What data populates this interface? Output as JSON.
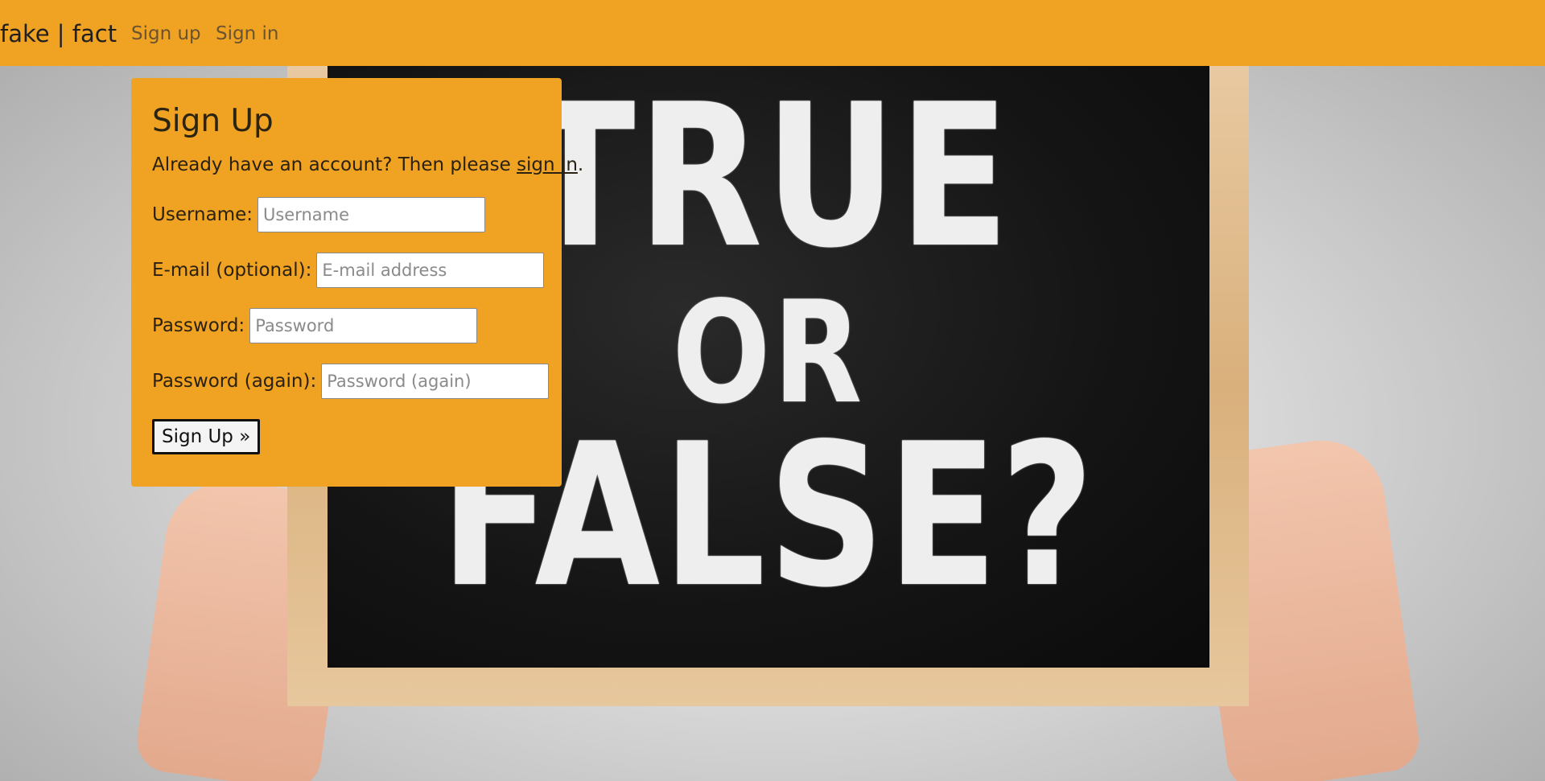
{
  "navbar": {
    "brand": "fake | fact",
    "links": [
      "Sign up",
      "Sign in"
    ]
  },
  "hero": {
    "board_lines": [
      "TRUE",
      "OR",
      "FALSE?"
    ]
  },
  "signup": {
    "title": "Sign Up",
    "intro_prefix": "Already have an account? Then please ",
    "intro_link": "sign in",
    "intro_suffix": ".",
    "fields": [
      {
        "label": "Username:",
        "placeholder": "Username"
      },
      {
        "label": "E-mail (optional):",
        "placeholder": "E-mail address"
      },
      {
        "label": "Password:",
        "placeholder": "Password"
      },
      {
        "label": "Password (again):",
        "placeholder": "Password (again)"
      }
    ],
    "submit_label": "Sign Up »"
  },
  "colors": {
    "accent": "#f0a223",
    "text": "#2a2110",
    "board": "#141414"
  }
}
